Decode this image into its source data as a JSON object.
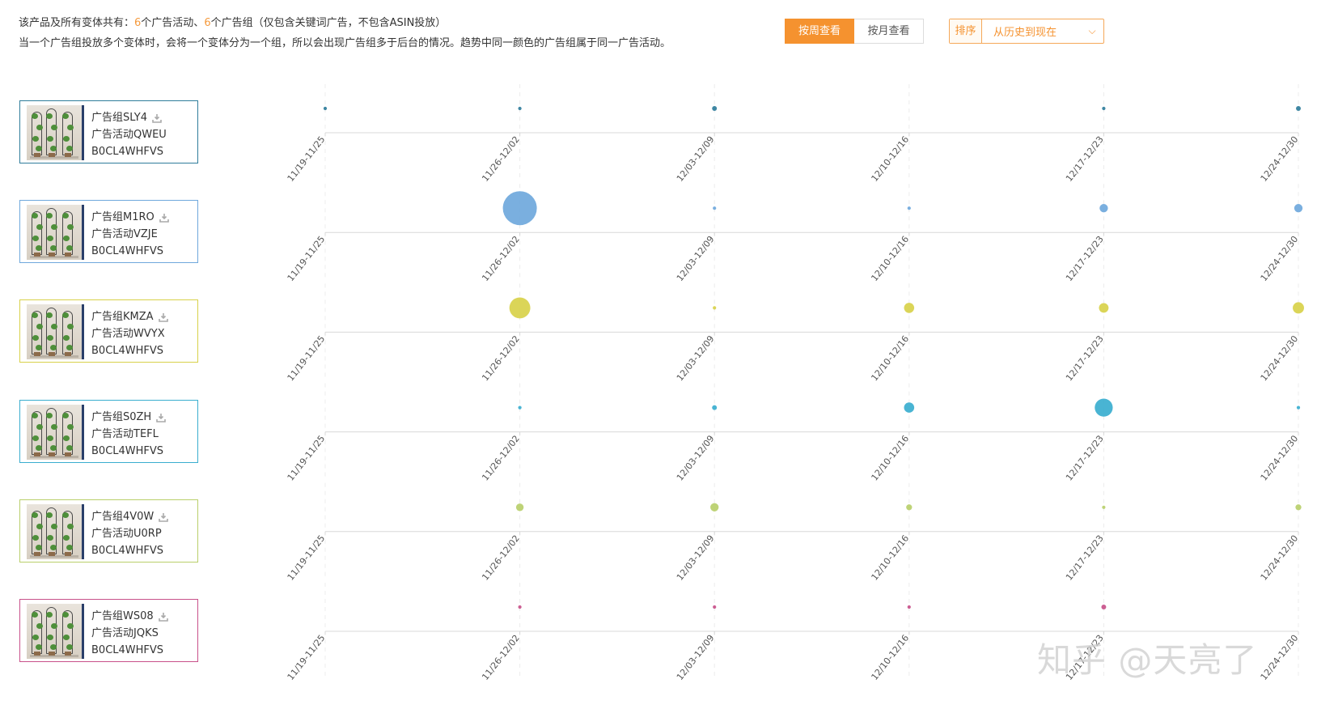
{
  "summary": {
    "line1_prefix": "该产品及所有变体共有：",
    "campaign_count": "6",
    "campaign_suffix": "个广告活动、",
    "group_count": "6",
    "group_suffix": "个广告组（仅包含关键词广告，不包含ASIN投放）",
    "line2": "当一个广告组投放多个变体时，会将一个变体分为一个组，所以会出现广告组多于后台的情况。趋势中同一颜色的广告组属于同一广告活动。"
  },
  "view_toggle": {
    "week_label": "按周查看",
    "month_label": "按月查看",
    "active": "week"
  },
  "sort": {
    "label": "排序",
    "value": "从历史到现在"
  },
  "groups": [
    {
      "name": "广告组SLY4",
      "campaign": "广告活动QWEU",
      "asin": "B0CL4WHFVS",
      "color": "#2f7d9b"
    },
    {
      "name": "广告组M1RO",
      "campaign": "广告活动VZJE",
      "asin": "B0CL4WHFVS",
      "color": "#6fa8dc"
    },
    {
      "name": "广告组KMZA",
      "campaign": "广告活动WVYX",
      "asin": "B0CL4WHFVS",
      "color": "#d8d14a"
    },
    {
      "name": "广告组S0ZH",
      "campaign": "广告活动TEFL",
      "asin": "B0CL4WHFVS",
      "color": "#3aaecf"
    },
    {
      "name": "广告组4V0W",
      "campaign": "广告活动U0RP",
      "asin": "B0CL4WHFVS",
      "color": "#b9cf6b"
    },
    {
      "name": "广告组WS08",
      "campaign": "广告活动JQKS",
      "asin": "B0CL4WHFVS",
      "color": "#c8518a"
    }
  ],
  "watermark": "知乎 @天亮了",
  "chart_data": {
    "type": "scatter",
    "x": [
      "11/19-11/25",
      "11/26-12/02",
      "12/03-12/09",
      "12/10-12/16",
      "12/17-12/23",
      "12/24-12/30"
    ],
    "size_encoding": "bubble",
    "series": [
      {
        "name": "广告组SLY4",
        "color": "#2f7d9b",
        "values": [
          1,
          1,
          2,
          0,
          1,
          2
        ]
      },
      {
        "name": "广告组M1RO",
        "color": "#6fa8dc",
        "values": [
          0,
          100,
          1,
          1,
          6,
          6
        ]
      },
      {
        "name": "广告组KMZA",
        "color": "#d8d14a",
        "values": [
          0,
          38,
          1,
          9,
          8,
          11
        ]
      },
      {
        "name": "广告组S0ZH",
        "color": "#3aaecf",
        "values": [
          0,
          1,
          2,
          9,
          28,
          1
        ]
      },
      {
        "name": "广告组4V0W",
        "color": "#b9cf6b",
        "values": [
          0,
          5,
          6,
          3,
          1,
          3
        ]
      },
      {
        "name": "广告组WS08",
        "color": "#c8518a",
        "values": [
          0,
          1,
          1,
          1,
          2,
          0
        ]
      }
    ]
  }
}
